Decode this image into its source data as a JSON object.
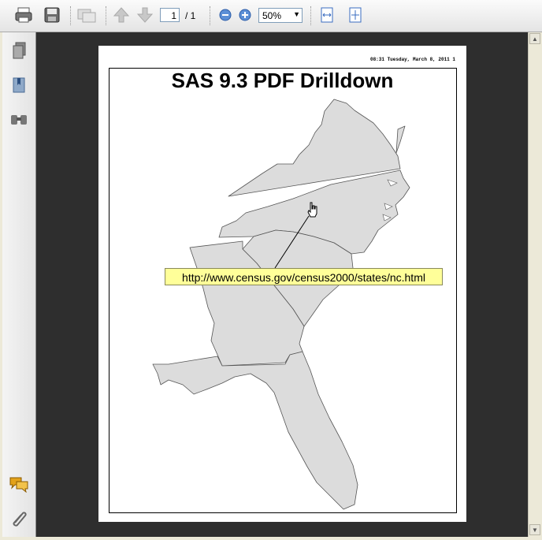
{
  "toolbar": {
    "icons": [
      "print-icon",
      "save-icon",
      "email-icon",
      "previous-page-icon",
      "next-page-icon",
      "zoom-out-icon",
      "zoom-in-icon",
      "fit-width-icon",
      "fit-page-icon"
    ],
    "page_current": "1",
    "page_total": "/ 1",
    "zoom": "50%"
  },
  "sidebar": {
    "icons": [
      "pages-icon",
      "bookmarks-icon",
      "search-icon",
      "comments-icon",
      "attachments-icon"
    ]
  },
  "document": {
    "stamp": "08:31 Tuesday, March 8, 2011  1",
    "title": "SAS 9.3 PDF Drilldown",
    "tooltip_url": "http://www.census.gov/census2000/states/nc.html"
  },
  "colors": {
    "viewer_bg": "#2e2e2e",
    "state_fill": "#dcdcdc",
    "tooltip_bg": "#ffff99"
  }
}
